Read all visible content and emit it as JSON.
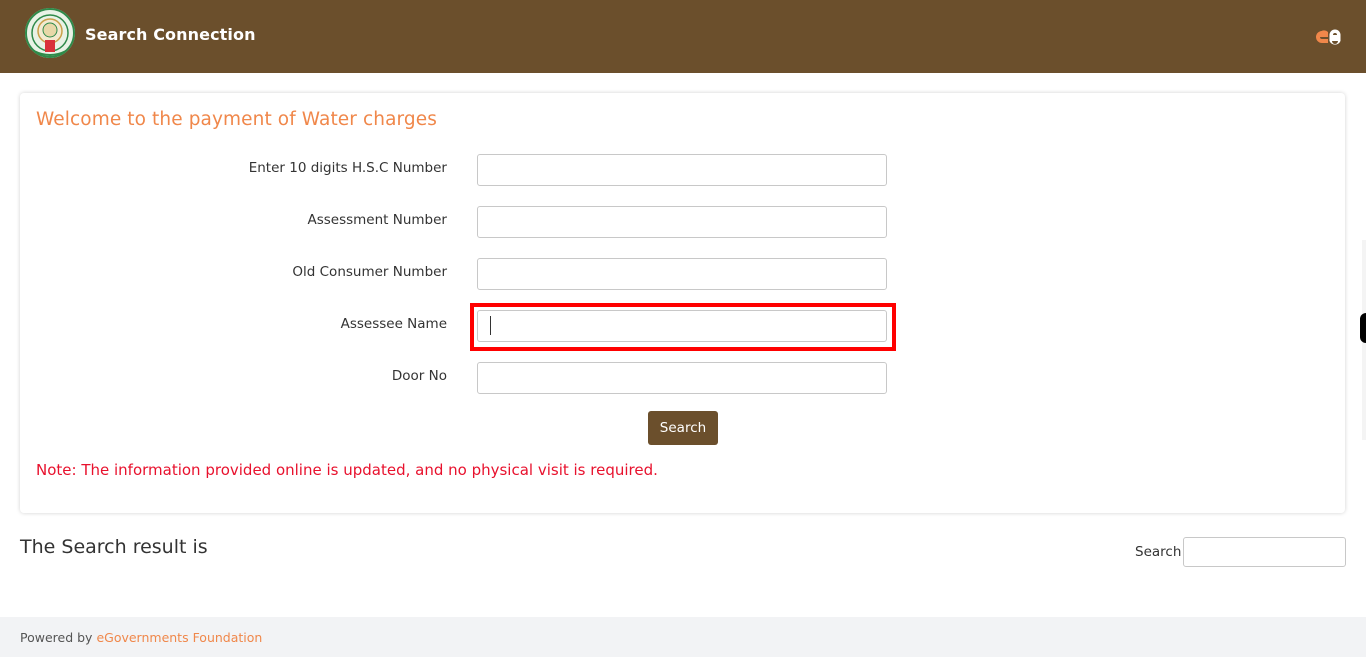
{
  "header": {
    "title": "Search Connection",
    "logo_icon": "state-emblem-icon",
    "brand_icon": "egov-logo-icon"
  },
  "card": {
    "title": "Welcome to the payment of Water charges",
    "fields": [
      {
        "label": "Enter 10 digits H.S.C Number",
        "value": "",
        "placeholder": ""
      },
      {
        "label": "Assessment Number",
        "value": "",
        "placeholder": ""
      },
      {
        "label": "Old Consumer Number",
        "value": "",
        "placeholder": ""
      },
      {
        "label": "Assessee Name",
        "value": "",
        "placeholder": "",
        "focused": true
      },
      {
        "label": "Door No",
        "value": "",
        "placeholder": ""
      }
    ],
    "search_button": "Search",
    "note": "Note: The information provided online is updated, and no physical visit is required."
  },
  "results": {
    "title": "The Search result is",
    "search_label": "Search",
    "search_value": ""
  },
  "footer": {
    "prefix": "Powered by ",
    "link_text": "eGovernments Foundation"
  },
  "colors": {
    "header_bg": "#6b4f2c",
    "accent_orange": "#f0874a",
    "note_red": "#e8112d",
    "highlight_red": "#ff0000"
  }
}
